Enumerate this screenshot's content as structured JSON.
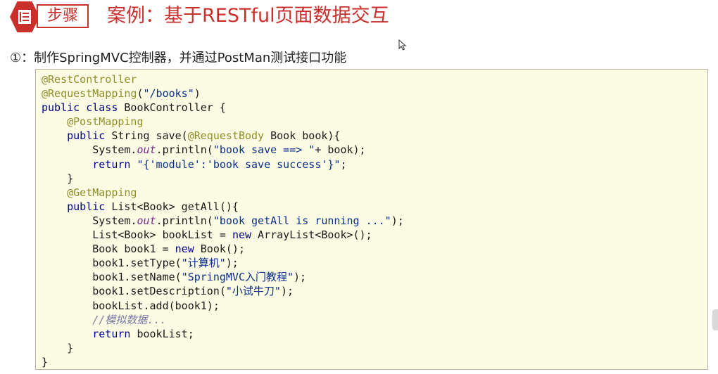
{
  "header": {
    "step_label": "步骤",
    "title": "案例：基于RESTful页面数据交互"
  },
  "step": {
    "text": "①：制作SpringMVC控制器，并通过PostMan测试接口功能"
  },
  "code_lines": [
    [
      [
        "ann",
        "@RestController"
      ]
    ],
    [
      [
        "ann",
        "@RequestMapping"
      ],
      [
        "t",
        "("
      ],
      [
        "str",
        "\"/books\""
      ],
      [
        "t",
        ")"
      ]
    ],
    [
      [
        "kw",
        "public class"
      ],
      [
        "t",
        " BookController {"
      ]
    ],
    [
      [
        "t",
        "    "
      ],
      [
        "ann",
        "@PostMapping"
      ]
    ],
    [
      [
        "t",
        "    "
      ],
      [
        "kw",
        "public"
      ],
      [
        "t",
        " String save("
      ],
      [
        "ann",
        "@RequestBody"
      ],
      [
        "t",
        " Book book){"
      ]
    ],
    [
      [
        "t",
        "        System."
      ],
      [
        "fld",
        "out"
      ],
      [
        "t",
        ".println("
      ],
      [
        "str",
        "\"book save ==> \""
      ],
      [
        "t",
        "+ book);"
      ]
    ],
    [
      [
        "t",
        "        "
      ],
      [
        "kw",
        "return"
      ],
      [
        "t",
        " "
      ],
      [
        "str",
        "\"{'module':'book save success'}\""
      ],
      [
        "t",
        ";"
      ]
    ],
    [
      [
        "t",
        "    }"
      ]
    ],
    [
      [
        "t",
        "    "
      ],
      [
        "ann",
        "@GetMapping"
      ]
    ],
    [
      [
        "t",
        "    "
      ],
      [
        "kw",
        "public"
      ],
      [
        "t",
        " List<Book> getAll(){"
      ]
    ],
    [
      [
        "t",
        "        System."
      ],
      [
        "fld",
        "out"
      ],
      [
        "t",
        ".println("
      ],
      [
        "str",
        "\"book getAll is running ...\""
      ],
      [
        "t",
        ");"
      ]
    ],
    [
      [
        "t",
        "        List<Book> bookList = "
      ],
      [
        "kw",
        "new"
      ],
      [
        "t",
        " ArrayList<Book>();"
      ]
    ],
    [
      [
        "t",
        "        Book book1 = "
      ],
      [
        "kw",
        "new"
      ],
      [
        "t",
        " Book();"
      ]
    ],
    [
      [
        "t",
        "        book1.setType("
      ],
      [
        "str",
        "\"计算机\""
      ],
      [
        "t",
        ");"
      ]
    ],
    [
      [
        "t",
        "        book1.setName("
      ],
      [
        "str",
        "\"SpringMVC入门教程\""
      ],
      [
        "t",
        ");"
      ]
    ],
    [
      [
        "t",
        "        book1.setDescription("
      ],
      [
        "str",
        "\"小试牛刀\""
      ],
      [
        "t",
        ");"
      ]
    ],
    [
      [
        "t",
        "        bookList.add(book1);"
      ]
    ],
    [
      [
        "t",
        "        "
      ],
      [
        "cmt",
        "//模拟数据..."
      ]
    ],
    [
      [
        "t",
        "        "
      ],
      [
        "kw",
        "return"
      ],
      [
        "t",
        " bookList;"
      ]
    ],
    [
      [
        "t",
        "    }"
      ]
    ],
    [
      [
        "t",
        "}"
      ]
    ]
  ]
}
